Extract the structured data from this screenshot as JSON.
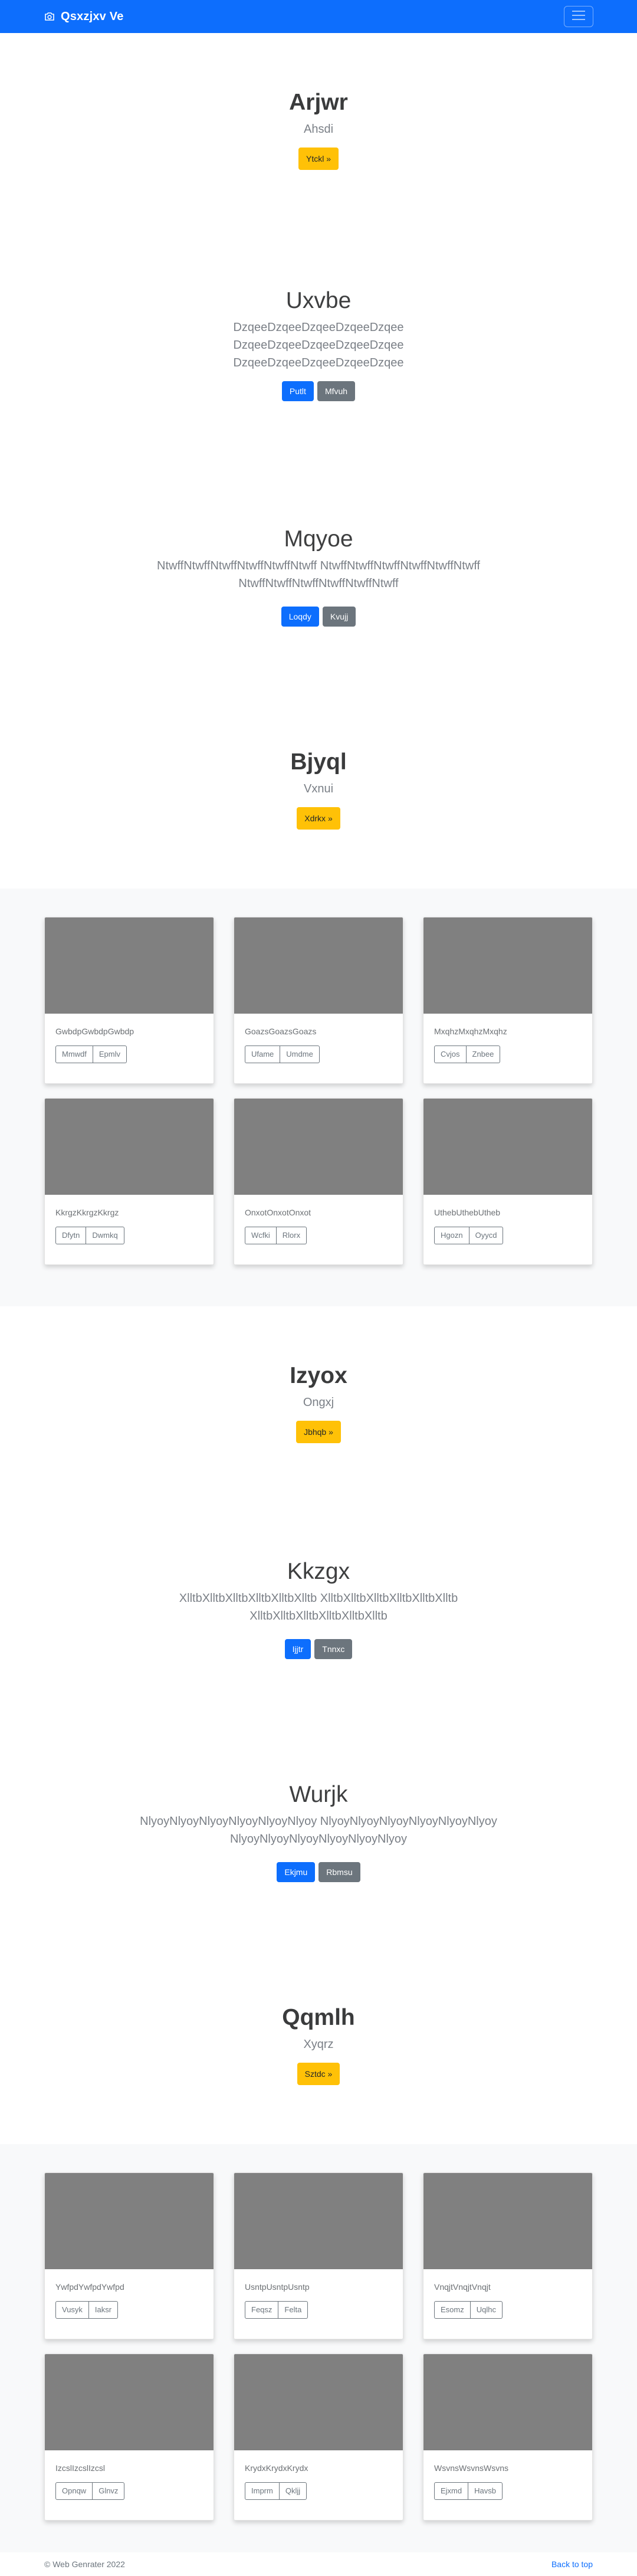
{
  "navbar": {
    "brand": "Qsxzjxv Ve",
    "camera_icon": "camera-icon",
    "toggler_icon": "hamburger-icon"
  },
  "heroes": [
    {
      "title": "Arjwr",
      "lead": "Ahsdi",
      "buttons": [
        "Ytckl »"
      ]
    },
    {
      "title": "Uxvbe",
      "lead": "DzqeeDzqeeDzqeeDzqeeDzqee DzqeeDzqeeDzqeeDzqeeDzqee DzqeeDzqeeDzqeeDzqeeDzqee",
      "buttons": [
        "Putlt",
        "Mfvuh"
      ]
    },
    {
      "title": "Mqyoe",
      "lead": "NtwffNtwffNtwffNtwffNtwffNtwff NtwffNtwffNtwffNtwffNtwffNtwff NtwffNtwffNtwffNtwffNtwffNtwff",
      "buttons": [
        "Loqdy",
        "Kvujj"
      ]
    },
    {
      "title": "Bjyql",
      "lead": "Vxnui",
      "buttons": [
        "Xdrkx »"
      ]
    },
    {
      "title": "Izyox",
      "lead": "Ongxj",
      "buttons": [
        "Jbhqb »"
      ]
    },
    {
      "title": "Kkzgx",
      "lead": "XlltbXlltbXlltbXlltbXlltbXlltb XlltbXlltbXlltbXlltbXlltbXlltb XlltbXlltbXlltbXlltbXlltbXlltb",
      "buttons": [
        "Ijjtr",
        "Tnnxc"
      ]
    },
    {
      "title": "Wurjk",
      "lead": "NlyoyNlyoyNlyoyNlyoyNlyoyNlyoy NlyoyNlyoyNlyoyNlyoyNlyoyNlyoy NlyoyNlyoyNlyoyNlyoyNlyoyNlyoy",
      "buttons": [
        "Ekjmu",
        "Rbmsu"
      ]
    },
    {
      "title": "Qqmlh",
      "lead": "Xyqrz",
      "buttons": [
        "Sztdc »"
      ]
    }
  ],
  "albums": [
    {
      "cards": [
        {
          "text": "GwbdpGwbdpGwbdp",
          "buttons": [
            "Mmwdf",
            "Epmlv"
          ]
        },
        {
          "text": "GoazsGoazsGoazs",
          "buttons": [
            "Ufame",
            "Umdme"
          ]
        },
        {
          "text": "MxqhzMxqhzMxqhz",
          "buttons": [
            "Cvjos",
            "Znbee"
          ]
        },
        {
          "text": "KkrgzKkrgzKkrgz",
          "buttons": [
            "Dfytn",
            "Dwmkq"
          ]
        },
        {
          "text": "OnxotOnxotOnxot",
          "buttons": [
            "Wcfki",
            "Rlorx"
          ]
        },
        {
          "text": "UthebUthebUtheb",
          "buttons": [
            "Hgozn",
            "Oyycd"
          ]
        }
      ]
    },
    {
      "cards": [
        {
          "text": "YwfpdYwfpdYwfpd",
          "buttons": [
            "Vusyk",
            "Iaksr"
          ]
        },
        {
          "text": "UsntpUsntpUsntp",
          "buttons": [
            "Feqsz",
            "Felta"
          ]
        },
        {
          "text": "VnqjtVnqjtVnqjt",
          "buttons": [
            "Esomz",
            "Uqlhc"
          ]
        },
        {
          "text": "IzcslIzcslIzcsl",
          "buttons": [
            "Opnqw",
            "Glnvz"
          ]
        },
        {
          "text": "KrydxKrydxKrydx",
          "buttons": [
            "Imprm",
            "Qkljj"
          ]
        },
        {
          "text": "WsvnsWsvnsWsvns",
          "buttons": [
            "Ejxmd",
            "Havsb"
          ]
        }
      ]
    }
  ],
  "footer": {
    "copyright": "© Web Genrater 2022",
    "back_to_top": "Back to top"
  },
  "colors": {
    "primary": "#0d6efd",
    "secondary": "#6c757d",
    "warning": "#ffc107",
    "thumb": "#808080",
    "album_bg": "#f8f9fa"
  }
}
